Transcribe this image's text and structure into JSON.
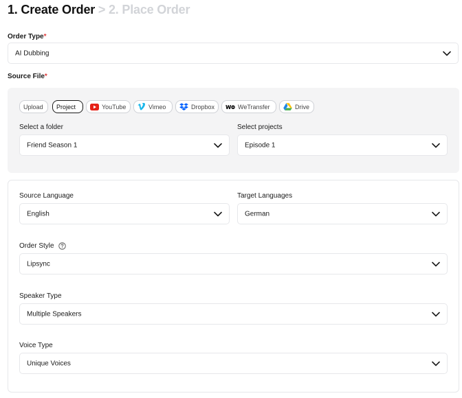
{
  "header": {
    "step1": "1. Create Order",
    "separator": ">",
    "step2": "2. Place Order"
  },
  "order_type": {
    "label": "Order Type",
    "required_mark": "*",
    "value": "AI Dubbing"
  },
  "source_file": {
    "label": "Source File",
    "required_mark": "*",
    "tabs": [
      {
        "label": "Upload",
        "icon": null,
        "active": false
      },
      {
        "label": "Project",
        "icon": null,
        "active": true
      },
      {
        "label": "YouTube",
        "icon": "youtube-icon",
        "active": false
      },
      {
        "label": "Vimeo",
        "icon": "vimeo-icon",
        "active": false
      },
      {
        "label": "Dropbox",
        "icon": "dropbox-icon",
        "active": false
      },
      {
        "label": "WeTransfer",
        "icon": "wetransfer-icon",
        "active": false
      },
      {
        "label": "Drive",
        "icon": "google-drive-icon",
        "active": false
      }
    ],
    "folder": {
      "label": "Select a folder",
      "value": "Friend Season 1"
    },
    "projects": {
      "label": "Select projects",
      "value": "Episode 1"
    }
  },
  "languages": {
    "source": {
      "label": "Source Language",
      "value": "English"
    },
    "target": {
      "label": "Target Languages",
      "value": "German"
    }
  },
  "order_style": {
    "label": "Order Style",
    "value": "Lipsync"
  },
  "speaker_type": {
    "label": "Speaker Type",
    "value": "Multiple Speakers"
  },
  "voice_type": {
    "label": "Voice Type",
    "value": "Unique Voices"
  },
  "colors": {
    "required": "#e03a3a",
    "panel_grey": "#f4f4f5",
    "border": "#e6e7ea",
    "youtube": "#e62117",
    "vimeo": "#1ab7ea",
    "dropbox": "#0061fe",
    "step_inactive": "#d2d4d8"
  }
}
